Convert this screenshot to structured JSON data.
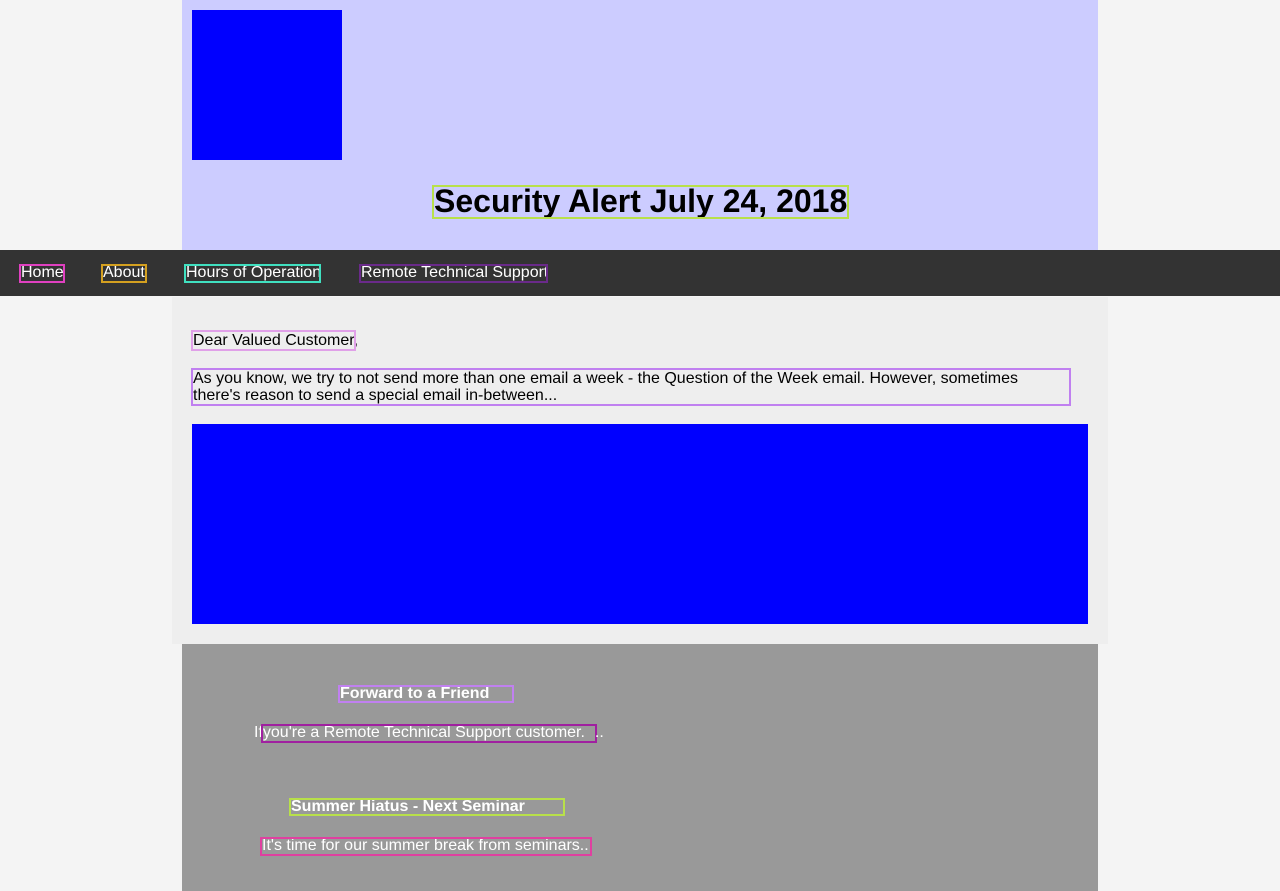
{
  "header": {
    "logo_icon": "logo-placeholder",
    "title": "Security Alert July 24, 2018"
  },
  "nav": {
    "items": [
      {
        "label": "Home"
      },
      {
        "label": "About"
      },
      {
        "label": "Hours of Operation"
      },
      {
        "label": "Remote Technical Support"
      }
    ]
  },
  "main": {
    "greeting": "Dear Valued Customer",
    "greeting_suffix": ",",
    "intro": "As you know, we try to not send more than one email a week - the Question of the Week email. However, sometimes there's reason to send a special email in-between...",
    "hero_image": "hero-image-placeholder"
  },
  "footer": {
    "articles": [
      {
        "title": "Forward to a Friend",
        "prefix": "If",
        "text": " you're a Remote Technical Support customer.",
        "suffix": ".."
      },
      {
        "title": "Summer Hiatus - Next Seminar",
        "prefix": "",
        "text": "It's time for our summer break from seminars..",
        "suffix": ""
      }
    ]
  },
  "colors": {
    "page_bg": "#f4f4f4",
    "header_bg": "#ccccff",
    "nav_bg": "#333333",
    "main_bg": "#eeeeee",
    "footer_bg": "#999999",
    "placeholder_blue": "#0000ff"
  }
}
